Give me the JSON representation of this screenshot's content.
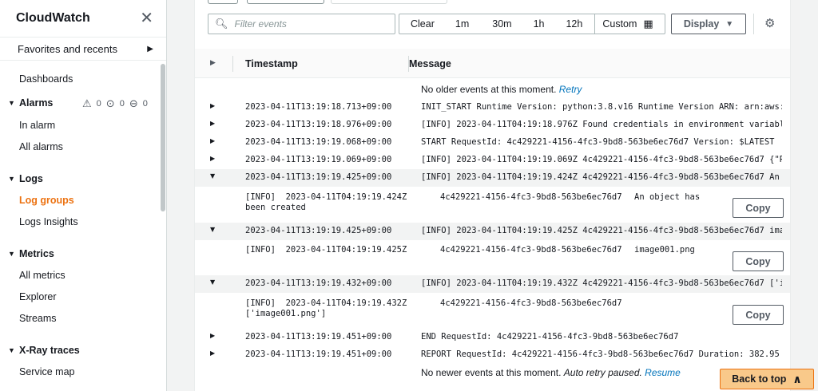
{
  "sidebar": {
    "title": "CloudWatch",
    "favorites": "Favorites and recents",
    "dashboards": "Dashboards",
    "alarms": {
      "label": "Alarms",
      "warn_count": "0",
      "ok_count": "0",
      "insufficient_count": "0",
      "in_alarm": "In alarm",
      "all_alarms": "All alarms"
    },
    "logs": {
      "label": "Logs",
      "log_groups": "Log groups",
      "log_insights": "Logs Insights"
    },
    "metrics": {
      "label": "Metrics",
      "all_metrics": "All metrics",
      "explorer": "Explorer",
      "streams": "Streams"
    },
    "xray": {
      "label": "X-Ray traces",
      "service_map": "Service map"
    }
  },
  "toolbar": {
    "filter_placeholder": "Filter events",
    "clear": "Clear",
    "r1m": "1m",
    "r30m": "30m",
    "r1h": "1h",
    "r12h": "12h",
    "custom": "Custom",
    "display": "Display"
  },
  "table": {
    "col_timestamp": "Timestamp",
    "col_message": "Message",
    "older_text": "No older events at this moment.",
    "older_link": "Retry",
    "newer_text": "No newer events at this moment.",
    "newer_italic": "Auto retry paused.",
    "newer_link": "Resume",
    "copy_label": "Copy",
    "rows": [
      {
        "ts": "2023-04-11T13:19:18.713+09:00",
        "msg": "INIT_START Runtime Version: python:3.8.v16 Runtime Version ARN: arn:aws:…"
      },
      {
        "ts": "2023-04-11T13:19:18.976+09:00",
        "msg": "[INFO] 2023-04-11T04:19:18.976Z Found credentials in environment variabl…"
      },
      {
        "ts": "2023-04-11T13:19:19.068+09:00",
        "msg": "START RequestId: 4c429221-4156-4fc3-9bd8-563be6ec76d7 Version: $LATEST"
      },
      {
        "ts": "2023-04-11T13:19:19.069+09:00",
        "msg": "[INFO] 2023-04-11T04:19:19.069Z 4c429221-4156-4fc3-9bd8-563be6ec76d7 {\"R…"
      },
      {
        "ts": "2023-04-11T13:19:19.425+09:00",
        "msg": "[INFO] 2023-04-11T04:19:19.424Z 4c429221-4156-4fc3-9bd8-563be6ec76d7 An …",
        "detail_a": "[INFO]  2023-04-11T04:19:19.424Z\nbeen created",
        "detail_b": "4c429221-4156-4fc3-9bd8-563be6ec76d7",
        "detail_c": "An object has"
      },
      {
        "ts": "2023-04-11T13:19:19.425+09:00",
        "msg": "[INFO] 2023-04-11T04:19:19.425Z 4c429221-4156-4fc3-9bd8-563be6ec76d7 ima…",
        "detail_a": "[INFO]  2023-04-11T04:19:19.425Z",
        "detail_b": "4c429221-4156-4fc3-9bd8-563be6ec76d7",
        "detail_c": "image001.png"
      },
      {
        "ts": "2023-04-11T13:19:19.432+09:00",
        "msg": "[INFO] 2023-04-11T04:19:19.432Z 4c429221-4156-4fc3-9bd8-563be6ec76d7 ['i…",
        "detail_a": "[INFO]  2023-04-11T04:19:19.432Z\n['image001.png']",
        "detail_b": "4c429221-4156-4fc3-9bd8-563be6ec76d7"
      },
      {
        "ts": "2023-04-11T13:19:19.451+09:00",
        "msg": "END RequestId: 4c429221-4156-4fc3-9bd8-563be6ec76d7"
      },
      {
        "ts": "2023-04-11T13:19:19.451+09:00",
        "msg": "REPORT RequestId: 4c429221-4156-4fc3-9bd8-563be6ec76d7 Duration: 382.95 …"
      }
    ]
  },
  "back_to_top": "Back to top"
}
